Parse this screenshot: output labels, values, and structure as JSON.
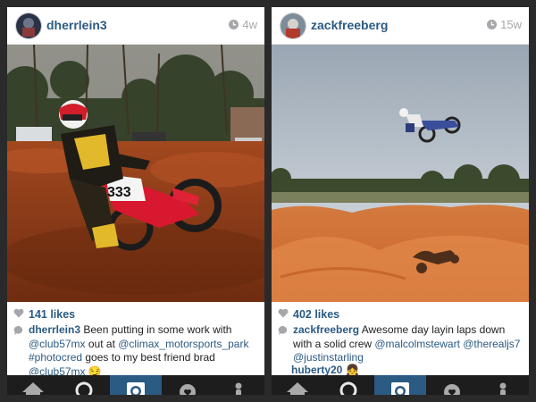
{
  "posts": [
    {
      "username": "dherrlein3",
      "time": "4w",
      "likes": "141 likes",
      "caption_user": "dherrlein3",
      "caption_parts": [
        {
          "text": " Been putting in some work with ",
          "tag": false
        },
        {
          "text": "@club57mx",
          "tag": true
        },
        {
          "text": " out at ",
          "tag": false
        },
        {
          "text": "@climax_motorsports_park",
          "tag": true
        },
        {
          "text": " ",
          "tag": false
        },
        {
          "text": "#photocred",
          "tag": true
        },
        {
          "text": " goes to my best friend brad ",
          "tag": false
        },
        {
          "text": "@club57mx",
          "tag": true
        },
        {
          "text": " 😏",
          "tag": false
        }
      ],
      "bike_number": "333"
    },
    {
      "username": "zackfreeberg",
      "time": "15w",
      "likes": "402 likes",
      "caption_user": "zackfreeberg",
      "caption_parts": [
        {
          "text": " Awesome day layin laps down with a solid crew ",
          "tag": false
        },
        {
          "text": "@malcolmstewart",
          "tag": true
        },
        {
          "text": " ",
          "tag": false
        },
        {
          "text": "@therealjs7",
          "tag": true
        },
        {
          "text": " ",
          "tag": false
        },
        {
          "text": "@justinstarling",
          "tag": true
        }
      ],
      "comment_user": "huberty20",
      "comment_emoji": "👧"
    }
  ],
  "tabbar": {
    "items": [
      "home-icon",
      "explore-icon",
      "camera-icon",
      "heart-icon",
      "profile-icon"
    ],
    "active_index": 2
  },
  "colors": {
    "link": "#2b5a83",
    "tabbar_bg": "#1d1d1d",
    "tab_active": "#2b5a83"
  }
}
